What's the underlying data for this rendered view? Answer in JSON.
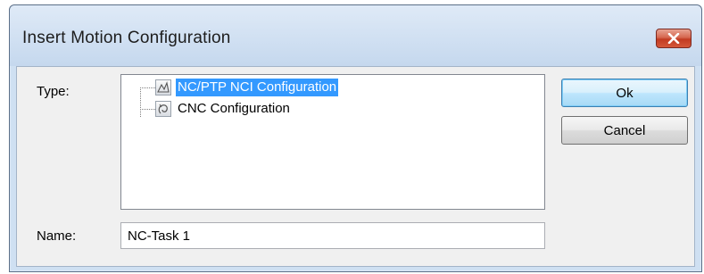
{
  "window": {
    "title": "Insert Motion Configuration",
    "close_icon": "close-icon"
  },
  "form": {
    "type_label": "Type:",
    "name_label": "Name:",
    "name_value": "NC-Task 1"
  },
  "tree": {
    "items": [
      {
        "label": "NC/PTP NCI Configuration",
        "icon": "nc-ptp-icon",
        "selected": true
      },
      {
        "label": "CNC Configuration",
        "icon": "cnc-icon",
        "selected": false
      }
    ]
  },
  "buttons": {
    "ok_label": "Ok",
    "cancel_label": "Cancel"
  },
  "colors": {
    "selection": "#3399ff",
    "title_bar": "#cfe0f2",
    "close_button": "#c23b22"
  }
}
